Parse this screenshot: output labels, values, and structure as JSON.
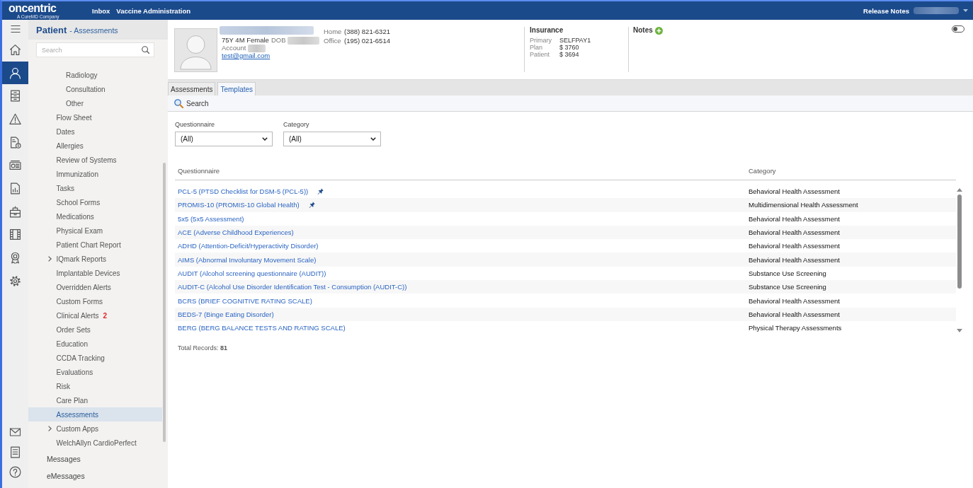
{
  "top_bar": {
    "logo": {
      "text": "oncentric",
      "tagline": "A CureMD Company"
    },
    "links": [
      "Inbox",
      "Vaccine Administration"
    ],
    "release_notes": "Release Notes",
    "user": {
      "blurred": true
    }
  },
  "nav_rail": {
    "items": [
      {
        "selected": false
      },
      {
        "selected": true
      },
      {
        "selected": false
      },
      {
        "selected": false
      },
      {
        "selected": false
      },
      {
        "selected": false
      },
      {
        "selected": false
      },
      {
        "selected": false
      },
      {
        "selected": false
      },
      {
        "selected": false
      },
      {
        "selected": false
      }
    ]
  },
  "sidebar": {
    "title": "Patient",
    "subtitle": "- Assessments",
    "search": {
      "placeholder": "Search"
    },
    "tree": [
      {
        "children": [
          {
            "children": [
              {
                "label": "Radiology",
                "selected": false
              },
              {
                "label": "Consultation",
                "selected": false
              },
              {
                "label": "Other",
                "selected": false
              }
            ]
          },
          {
            "label": "Flow Sheet",
            "selected": false
          },
          {
            "label": "Dates",
            "selected": false
          },
          {
            "label": "Allergies",
            "selected": false
          },
          {
            "label": "Review of Systems",
            "selected": false
          },
          {
            "label": "Immunization",
            "selected": false
          },
          {
            "label": "Tasks",
            "selected": false
          },
          {
            "label": "School Forms",
            "selected": false
          },
          {
            "label": "Medications",
            "selected": false
          },
          {
            "label": "Physical Exam",
            "selected": false
          },
          {
            "label": "Patient Chart Report",
            "selected": false
          },
          {
            "label": "IQmark Reports",
            "selected": false,
            "expanded": false
          },
          {
            "label": "Implantable Devices",
            "selected": false
          },
          {
            "label": "Overridden Alerts",
            "selected": false
          },
          {
            "label": "Custom Forms",
            "selected": false
          },
          {
            "label": "Clinical Alerts",
            "selected": false,
            "badge": "2"
          },
          {
            "label": "Order Sets",
            "selected": false
          },
          {
            "label": "Education",
            "selected": false
          },
          {
            "label": "CCDA Tracking",
            "selected": false
          },
          {
            "label": "Evaluations",
            "selected": false
          },
          {
            "label": "Risk",
            "selected": false
          },
          {
            "label": "Care Plan",
            "selected": false
          },
          {
            "label": "Assessments",
            "selected": true
          },
          {
            "label": "Custom Apps",
            "selected": false,
            "expanded": false
          },
          {
            "label": "WelchAllyn CardioPerfect",
            "selected": false
          }
        ]
      },
      {
        "label": "Messages",
        "selected": false
      },
      {
        "label": "eMessages",
        "selected": false
      }
    ]
  },
  "patient": {
    "name": {
      "blurred": true
    },
    "summary": "75Y 4M Female",
    "dob": {
      "label": "DOB",
      "blurred": true
    },
    "account": {
      "label": "Account",
      "blurred": true
    },
    "email": "test@gmail.com",
    "phones": [
      {
        "label": "Home",
        "value": "(388) 821-6321"
      },
      {
        "label": "Office",
        "value": "(195) 021-6514"
      }
    ]
  },
  "insurance": {
    "title": "Insurance",
    "rows": [
      {
        "label": "Primary",
        "value": "SELFPAY1"
      },
      {
        "label": "Plan",
        "value": "$ 3760"
      },
      {
        "label": "Patient",
        "value": "$ 3694"
      }
    ]
  },
  "notes": {
    "title": "Notes"
  },
  "toggle": {
    "on": false
  },
  "tabs": [
    {
      "label": "Assessments",
      "selected": false
    },
    {
      "label": "Templates",
      "selected": true
    }
  ],
  "toolbar": {
    "search": "Search"
  },
  "filters": [
    {
      "label": "Questionnaire",
      "value": "(All)"
    },
    {
      "label": "Category",
      "value": "(All)"
    }
  ],
  "table": {
    "columns": [
      "Questionnaire",
      "Category"
    ],
    "rows": [
      {
        "questionnaire": "PCL-5 (PTSD Checklist for DSM-5 (PCL-5))",
        "category": "Behavioral Health Assessment",
        "pinned": true
      },
      {
        "questionnaire": "PROMIS-10 (PROMIS-10 Global Health)",
        "category": "Multidimensional Health Assessment",
        "pinned": true
      },
      {
        "questionnaire": "5x5 (5x5 Assessment)",
        "category": "Behavioral Health Assessment",
        "pinned": false
      },
      {
        "questionnaire": "ACE (Adverse Childhood Experiences)",
        "category": "Behavioral Health Assessment",
        "pinned": false
      },
      {
        "questionnaire": "ADHD (Attention-Deficit/Hyperactivity Disorder)",
        "category": "Behavioral Health Assessment",
        "pinned": false
      },
      {
        "questionnaire": "AIMS (Abnormal Involuntary Movement Scale)",
        "category": "Behavioral Health Assessment",
        "pinned": false
      },
      {
        "questionnaire": "AUDIT (Alcohol screening questionnaire (AUDIT))",
        "category": "Substance Use Screening",
        "pinned": false
      },
      {
        "questionnaire": "AUDIT-C (Alcohol Use Disorder Identification Test - Consumption (AUDIT-C))",
        "category": "Substance Use Screening",
        "pinned": false
      },
      {
        "questionnaire": "BCRS (BRIEF COGNITIVE RATING SCALE)",
        "category": "Behavioral Health Assessment",
        "pinned": false
      },
      {
        "questionnaire": "BEDS-7 (Binge Eating Disorder)",
        "category": "Behavioral Health Assessment",
        "pinned": false
      },
      {
        "questionnaire": "BERG (BERG BALANCE TESTS AND RATING SCALE)",
        "category": "Physical Therapy Assessments",
        "pinned": false
      }
    ],
    "total": "Total Records: **81**"
  }
}
